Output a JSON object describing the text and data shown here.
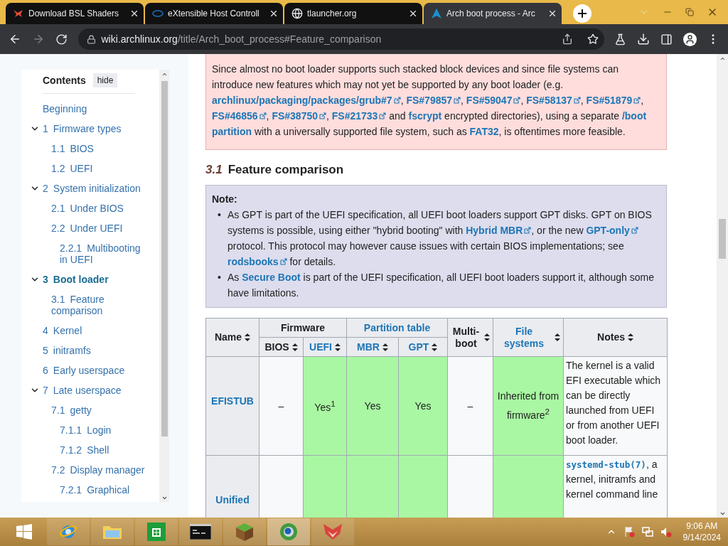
{
  "browser": {
    "tabs": [
      {
        "title": "Download BSL Shaders",
        "selected": false
      },
      {
        "title": "eXtensible Host Controll",
        "selected": false
      },
      {
        "title": "tlauncher.org",
        "selected": false
      },
      {
        "title": "Arch boot process - Arc",
        "selected": true
      }
    ],
    "nav": {
      "back": {
        "disabled": false
      },
      "forward": {
        "disabled": true
      }
    },
    "address": {
      "domain": "wiki.archlinux.org",
      "path": "/title/Arch_boot_process#Feature_comparison"
    }
  },
  "toc": {
    "title": "Contents",
    "hide": "hide",
    "items": [
      {
        "label": "Beginning",
        "selected": false
      },
      {
        "number": "1",
        "label": "Firmware types",
        "selected": false,
        "expanded": true,
        "children": [
          {
            "number": "1.1",
            "label": "BIOS",
            "selected": false
          },
          {
            "number": "1.2",
            "label": "UEFI",
            "selected": false
          }
        ]
      },
      {
        "number": "2",
        "label": "System initialization",
        "selected": false,
        "expanded": true,
        "children": [
          {
            "number": "2.1",
            "label": "Under BIOS",
            "selected": false
          },
          {
            "number": "2.2",
            "label": "Under UEFI",
            "selected": false,
            "children": [
              {
                "number": "2.2.1",
                "label": "Multibooting in UEFI",
                "selected": false
              }
            ]
          }
        ]
      },
      {
        "number": "3",
        "label": "Boot loader",
        "selected": true,
        "expanded": true,
        "children": [
          {
            "number": "3.1",
            "label": "Feature comparison",
            "selected": false
          }
        ]
      },
      {
        "number": "4",
        "label": "Kernel",
        "selected": false
      },
      {
        "number": "5",
        "label": "initramfs",
        "selected": false
      },
      {
        "number": "6",
        "label": "Early userspace",
        "selected": false
      },
      {
        "number": "7",
        "label": "Late userspace",
        "selected": false,
        "expanded": true,
        "children": [
          {
            "number": "7.1",
            "label": "getty",
            "selected": false,
            "children": [
              {
                "number": "7.1.1",
                "label": "Login",
                "selected": false
              },
              {
                "number": "7.1.2",
                "label": "Shell",
                "selected": false
              }
            ]
          },
          {
            "number": "7.2",
            "label": "Display manager",
            "selected": false,
            "children": [
              {
                "number": "7.2.1",
                "label": "Graphical",
                "selected": false
              }
            ]
          }
        ]
      }
    ]
  },
  "warning": {
    "segments": [
      {
        "kind": "text",
        "text": "Since almost no boot loader supports such stacked block devices and since file systems can introduce new features which may not yet be supported by any boot loader (e.g. "
      },
      {
        "kind": "ext",
        "text": "archlinux/packaging/packages/grub#7"
      },
      {
        "kind": "text",
        "text": ", "
      },
      {
        "kind": "ext",
        "text": "FS#79857"
      },
      {
        "kind": "text",
        "text": ", "
      },
      {
        "kind": "ext",
        "text": "FS#59047"
      },
      {
        "kind": "text",
        "text": ", "
      },
      {
        "kind": "ext",
        "text": "FS#58137"
      },
      {
        "kind": "text",
        "text": ", "
      },
      {
        "kind": "ext",
        "text": "FS#51879"
      },
      {
        "kind": "text",
        "text": ", "
      },
      {
        "kind": "ext",
        "text": "FS#46856"
      },
      {
        "kind": "text",
        "text": ", "
      },
      {
        "kind": "ext",
        "text": "FS#38750"
      },
      {
        "kind": "text",
        "text": ", "
      },
      {
        "kind": "ext",
        "text": "FS#21733"
      },
      {
        "kind": "text",
        "text": " and "
      },
      {
        "kind": "link",
        "text": "fscrypt"
      },
      {
        "kind": "text",
        "text": " encrypted directories), using a separate "
      },
      {
        "kind": "link",
        "text": "/boot"
      },
      {
        "kind": "link",
        "text": "partition"
      },
      {
        "kind": "text",
        "text": " with a universally supported file system, such as "
      },
      {
        "kind": "link",
        "text": "FAT32"
      },
      {
        "kind": "text",
        "text": ", is oftentimes more feasible."
      }
    ]
  },
  "section": {
    "number": "3.1",
    "title": "Feature comparison"
  },
  "note": {
    "label": "Note:",
    "bullet": "•",
    "items": [
      [
        {
          "kind": "text",
          "text": "As GPT is part of the UEFI specification, all UEFI boot loaders support GPT disks. GPT on BIOS systems is possible, using either \"hybrid booting\" with "
        },
        {
          "kind": "ext",
          "text": "Hybrid MBR"
        },
        {
          "kind": "text",
          "text": ", or the new "
        },
        {
          "kind": "ext",
          "text": "GPT-only"
        },
        {
          "kind": "text",
          "text": " protocol. This protocol may however cause issues with certain BIOS implementations; see "
        },
        {
          "kind": "ext",
          "text": "rodsbooks"
        },
        {
          "kind": "text",
          "text": " for details."
        }
      ],
      [
        {
          "kind": "text",
          "text": "As "
        },
        {
          "kind": "link",
          "text": "Secure Boot"
        },
        {
          "kind": "text",
          "text": " is part of the UEFI specification, all UEFI boot loaders support it, although some have limitations."
        }
      ]
    ]
  },
  "table": {
    "headers": [
      {
        "label": "Name",
        "link": false
      },
      {
        "label": "Firmware",
        "link": false,
        "sub": [
          {
            "label": "BIOS",
            "link": false
          },
          {
            "label": "UEFI",
            "link": true
          }
        ]
      },
      {
        "label": "Partition table",
        "link": true,
        "sub": [
          {
            "label": "MBR",
            "link": true
          },
          {
            "label": "GPT",
            "link": true
          }
        ]
      },
      {
        "label": "Multi-boot",
        "link": false
      },
      {
        "label": "File systems",
        "link": true
      },
      {
        "label": "Notes",
        "link": false
      }
    ],
    "rows": [
      {
        "name": "EFISTUB",
        "cells": [
          {
            "kind": "no",
            "text": "–"
          },
          {
            "kind": "yes",
            "text": "Yes$^{1}$"
          },
          {
            "kind": "yes",
            "text": "Yes"
          },
          {
            "kind": "yes",
            "text": "Yes"
          },
          {
            "kind": "no",
            "text": "–"
          },
          {
            "kind": "yes",
            "text": "Inherited from firmware$^{2}$"
          }
        ],
        "notes": [
          {
            "kind": "text",
            "text": "The kernel is a valid EFI executable which can be directly launched from UEFI or from another UEFI boot loader."
          }
        ]
      },
      {
        "name": "Unified",
        "cells": [
          {
            "kind": "no"
          },
          {
            "kind": "yes"
          },
          {
            "kind": "yes"
          },
          {
            "kind": "yes"
          },
          {
            "kind": "no"
          },
          {
            "kind": "yes"
          }
        ],
        "notes": [
          {
            "kind": "code",
            "text": "systemd-stub(7)"
          },
          {
            "kind": "text",
            "text": ", a kernel, initramfs and kernel command line"
          }
        ]
      }
    ]
  },
  "taskbar": {
    "apps": [
      {
        "kind": "start",
        "selected": false
      },
      {
        "kind": "ie",
        "selected": false
      },
      {
        "kind": "folder",
        "selected": false
      },
      {
        "kind": "store",
        "selected": false
      },
      {
        "kind": "terminal",
        "selected": false
      },
      {
        "kind": "cube",
        "selected": false
      },
      {
        "kind": "browser",
        "selected": true
      },
      {
        "kind": "fox",
        "selected": false
      }
    ],
    "time": "9:06 AM",
    "date": "9/14/2024"
  }
}
